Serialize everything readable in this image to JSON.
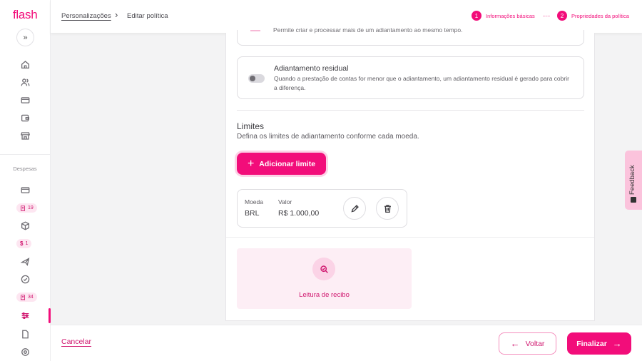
{
  "app": {
    "logo": "flash"
  },
  "breadcrumb": {
    "parent": "Personalizações",
    "separator": "›",
    "current": "Editar política"
  },
  "steps": [
    {
      "number": "1",
      "label": "Informações básicas"
    },
    {
      "number": "2",
      "label": "Propriedades da política"
    }
  ],
  "sidebar": {
    "collapse_label": "»",
    "section_label": "Despesas",
    "badges": [
      {
        "icon": "receipt-icon",
        "count": "19"
      },
      {
        "icon": "dollar-icon",
        "count": "1"
      },
      {
        "icon": "receipt-icon",
        "count": "34"
      }
    ]
  },
  "options": {
    "top_partial_desc": "Permite criar e processar mais de um adiantamento ao mesmo tempo.",
    "residual": {
      "title": "Adiantamento residual",
      "description": "Quando a prestação de contas for menor que o adiantamento, um adiantamento residual é gerado para cobrir a diferença.",
      "enabled": false
    }
  },
  "limits": {
    "title": "Limites",
    "subtitle": "Defina os limites de adiantamento conforme cada moeda.",
    "add_button": "Adicionar limite",
    "items": [
      {
        "currency_label": "Moeda",
        "currency": "BRL",
        "value_label": "Valor",
        "value": "R$ 1.000,00"
      }
    ]
  },
  "receipt_card": {
    "label": "Leitura de recibo"
  },
  "feedback": {
    "label": "Feedback"
  },
  "footer": {
    "cancel": "Cancelar",
    "back": "Voltar",
    "finish": "Finalizar"
  },
  "colors": {
    "accent": "#f20d7a",
    "accent_light": "#fdeef5"
  }
}
